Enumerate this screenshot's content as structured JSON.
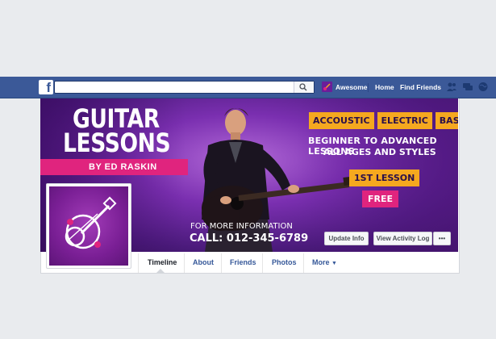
{
  "topbar": {
    "search_placeholder": "",
    "profile_name": "Awesome",
    "home_label": "Home",
    "find_friends_label": "Find Friends",
    "brand_color": "#3b5998"
  },
  "cover": {
    "title_line1": "GUITAR",
    "title_line2": "LESSONS",
    "byline": "BY ED RASKIN",
    "tags": [
      "ACCOUSTIC",
      "ELECTRIC",
      "BASS"
    ],
    "tagline1": "BEGINNER TO ADVANCED LESSONS",
    "tagline2": "ALL AGES AND STYLES",
    "offer": "1ST LESSON",
    "offer_price": "FREE",
    "info_line1": "FOR MORE INFORMATION",
    "info_line2": "CALL: 012-345-6789",
    "accent_orange": "#f5a81f",
    "accent_pink": "#e0247e",
    "bg_purple": "#7a2fb0"
  },
  "actions": {
    "update_info": "Update Info",
    "activity_log": "View Activity Log",
    "more_dots": "•••"
  },
  "tabs": [
    "Timeline",
    "About",
    "Friends",
    "Photos",
    "More"
  ]
}
